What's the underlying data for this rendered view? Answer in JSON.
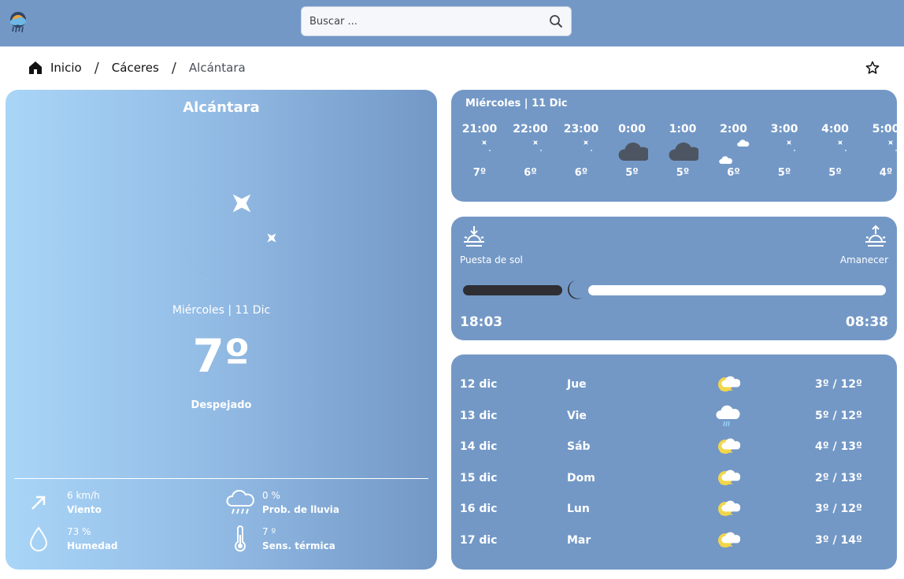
{
  "search": {
    "placeholder": "Buscar ..."
  },
  "icons": {
    "logo": "weather-app-logo",
    "search": "search-icon",
    "home": "home-icon",
    "favorite": "star-outline-icon"
  },
  "breadcrumb": {
    "home": "Inicio",
    "province": "Cáceres",
    "city": "Alcántara",
    "separator": "/"
  },
  "current": {
    "city": "Alcántara",
    "date": "Miércoles | 11 Dic",
    "temperature": "7º",
    "condition": "Despejado",
    "condition_icon": "clear-night-icon",
    "wind": {
      "value": "6 km/h",
      "label": "Viento",
      "icon": "wind-arrow-icon"
    },
    "rain": {
      "value": "0 %",
      "label": "Prob. de lluvia",
      "icon": "rain-cloud-icon"
    },
    "humidity": {
      "value": "73 %",
      "label": "Humedad",
      "icon": "droplet-icon"
    },
    "feels": {
      "value": "7 º",
      "label": "Sens. térmica",
      "icon": "thermometer-icon"
    }
  },
  "hourly": {
    "title": "Miércoles | 11 Dic",
    "items": [
      {
        "hour": "21:00",
        "temp": "7º",
        "icon": "clear-night-icon"
      },
      {
        "hour": "22:00",
        "temp": "6º",
        "icon": "clear-night-icon"
      },
      {
        "hour": "23:00",
        "temp": "6º",
        "icon": "clear-night-icon"
      },
      {
        "hour": "0:00",
        "temp": "5º",
        "icon": "cloud-icon"
      },
      {
        "hour": "1:00",
        "temp": "5º",
        "icon": "cloud-icon"
      },
      {
        "hour": "2:00",
        "temp": "6º",
        "icon": "partly-cloudy-night-icon"
      },
      {
        "hour": "3:00",
        "temp": "5º",
        "icon": "clear-night-icon"
      },
      {
        "hour": "4:00",
        "temp": "5º",
        "icon": "clear-night-icon"
      },
      {
        "hour": "5:00",
        "temp": "4º",
        "icon": "clear-night-icon"
      }
    ]
  },
  "sun": {
    "sunset_label": "Puesta de sol",
    "sunrise_label": "Amanecer",
    "sunset_time": "18:03",
    "sunrise_time": "08:38",
    "night_progress": 0.2
  },
  "daily": [
    {
      "date": "12 dic",
      "day": "Jue",
      "icon": "partly-sunny-icon",
      "temps": "3º / 12º"
    },
    {
      "date": "13 dic",
      "day": "Vie",
      "icon": "rain-icon",
      "temps": "5º / 12º"
    },
    {
      "date": "14 dic",
      "day": "Sáb",
      "icon": "partly-sunny-icon",
      "temps": "4º / 13º"
    },
    {
      "date": "15 dic",
      "day": "Dom",
      "icon": "partly-sunny-icon",
      "temps": "2º / 13º"
    },
    {
      "date": "16 dic",
      "day": "Lun",
      "icon": "partly-sunny-icon",
      "temps": "3º / 12º"
    },
    {
      "date": "17 dic",
      "day": "Mar",
      "icon": "partly-sunny-icon",
      "temps": "3º / 14º"
    }
  ],
  "colors": {
    "accent": "#7398c6",
    "moon": "#4d5563",
    "light_blue": "#a9d5f7",
    "sun_yellow": "#f2d64b"
  }
}
